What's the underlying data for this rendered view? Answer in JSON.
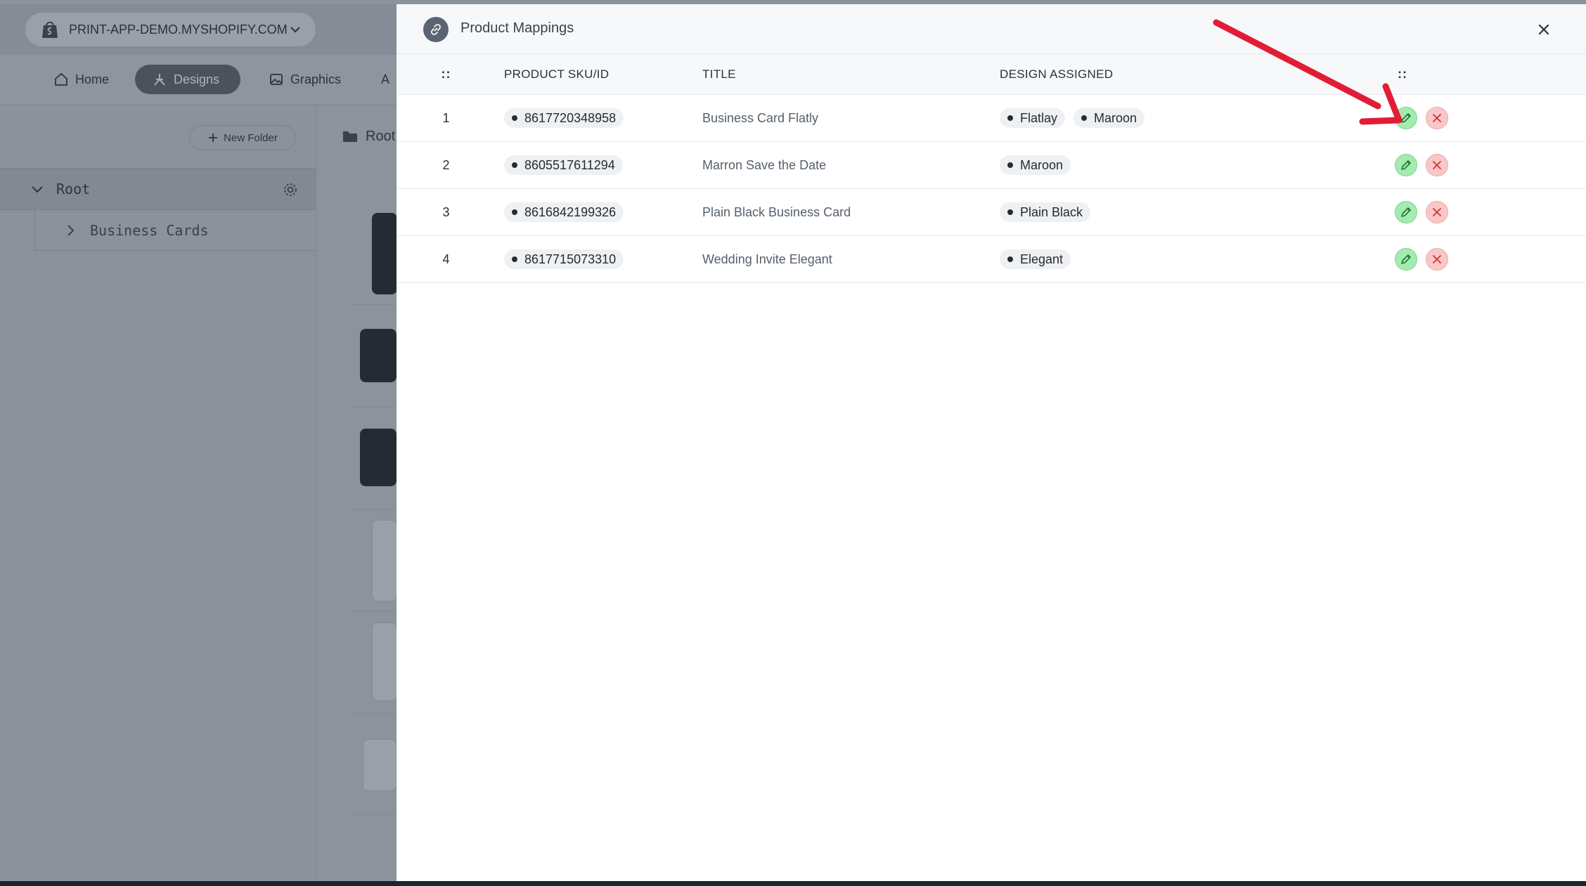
{
  "store": {
    "name": "PRINT-APP-DEMO.MYSHOPIFY.COM"
  },
  "nav": {
    "home": "Home",
    "designs": "Designs",
    "graphics": "Graphics",
    "more": "A"
  },
  "sidebar": {
    "new_folder": "New Folder",
    "root_label": "Root",
    "child_label": "Business Cards"
  },
  "content": {
    "breadcrumb": "Root"
  },
  "modal": {
    "title": "Product Mappings",
    "columns": {
      "drag": "::",
      "sku": "PRODUCT SKU/ID",
      "title": "TITLE",
      "design": "DESIGN ASSIGNED",
      "actions": "::"
    },
    "rows": [
      {
        "index": "1",
        "sku": "8617720348958",
        "title": "Business Card Flatly",
        "designs": [
          "Flatlay",
          "Maroon"
        ]
      },
      {
        "index": "2",
        "sku": "8605517611294",
        "title": "Marron Save the Date",
        "designs": [
          "Maroon"
        ]
      },
      {
        "index": "3",
        "sku": "8616842199326",
        "title": "Plain Black Business Card",
        "designs": [
          "Plain Black"
        ]
      },
      {
        "index": "4",
        "sku": "8617715073310",
        "title": "Wedding Invite Elegant",
        "designs": [
          "Elegant"
        ]
      }
    ]
  },
  "icons": {
    "edit": "pencil-icon",
    "delete": "x-icon",
    "close": "close-icon",
    "modal": "link-icon"
  },
  "colors": {
    "accent_bar": "#1f57b3",
    "edit_button": "#a4ebb0",
    "delete_button": "#f9c7c8",
    "annotation_arrow": "#e11d36"
  }
}
